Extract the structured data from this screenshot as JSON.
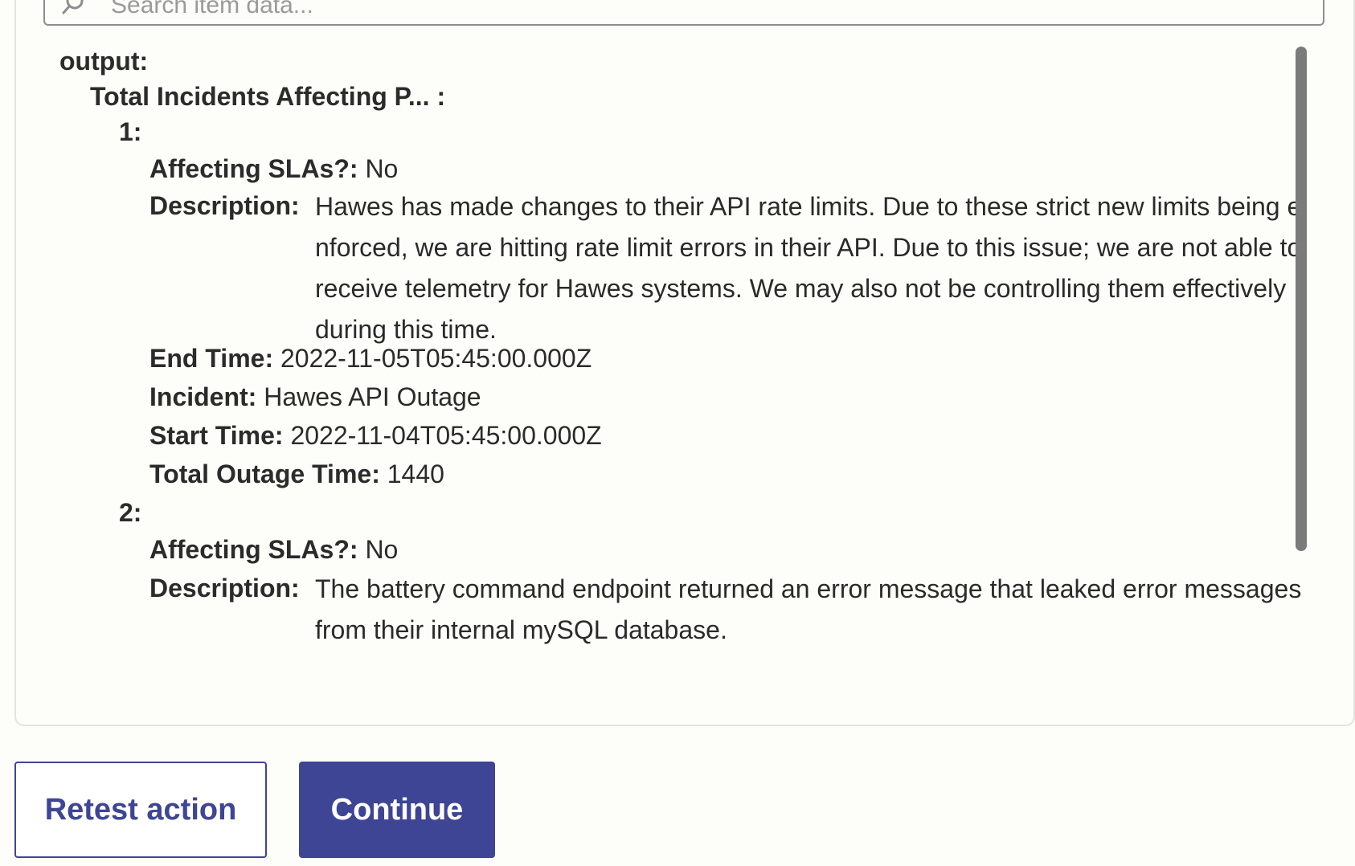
{
  "search": {
    "placeholder": "Search item data..."
  },
  "tree": {
    "root_key": "output:",
    "group_key": "Total Incidents Affecting P... :",
    "items": [
      {
        "index": "1:",
        "affecting_slas_key": "Affecting SLAs?:",
        "affecting_slas_value": "No",
        "description_key": "Description:",
        "description_value": "Hawes has made changes to their API rate limits. Due to these strict new limits being enforced, we are hitting rate limit errors in their API. Due to this issue; we are not able to receive telemetry for Hawes systems. We may also not be controlling them effectively during this time.",
        "end_time_key": "End Time:",
        "end_time_value": "2022-11-05T05:45:00.000Z",
        "incident_key": "Incident:",
        "incident_value": "Hawes API Outage",
        "start_time_key": "Start Time:",
        "start_time_value": "2022-11-04T05:45:00.000Z",
        "total_outage_key": "Total Outage Time:",
        "total_outage_value": "1440"
      },
      {
        "index": "2:",
        "affecting_slas_key": "Affecting SLAs?:",
        "affecting_slas_value": "No",
        "description_key": "Description:",
        "description_value": "The battery command endpoint returned an error message that leaked error messages from their internal mySQL database."
      }
    ]
  },
  "actions": {
    "retest_label": "Retest action",
    "continue_label": "Continue"
  },
  "colors": {
    "primary": "#3e4595",
    "scrollbar": "#7b7b7b"
  },
  "icons": {
    "search": "search-icon"
  }
}
